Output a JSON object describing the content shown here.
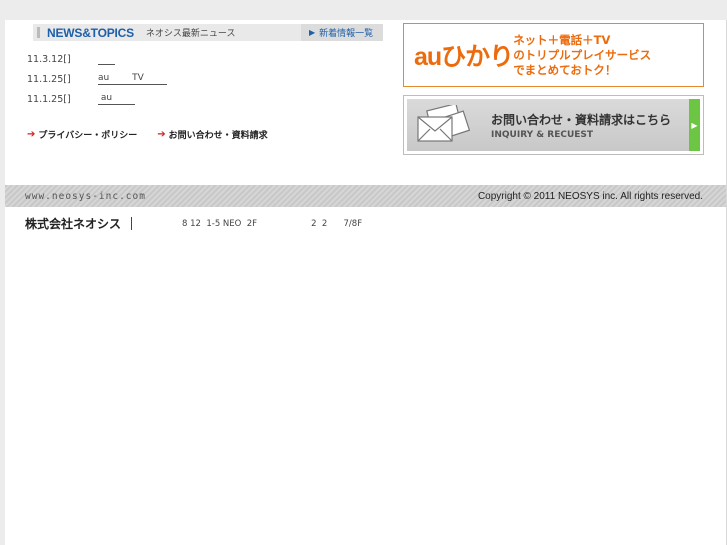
{
  "news": {
    "title": "NEWS&TOPICS",
    "subtitle": "ネオシス最新ニュース",
    "all_link": "新着情報一覧",
    "items": [
      {
        "date": "11.3.12[]",
        "text": "      "
      },
      {
        "date": "11.1.25[]",
        "text": "au        TV        "
      },
      {
        "date": "11.1.25[]",
        "text": " au        "
      }
    ]
  },
  "links": {
    "privacy": "プライバシー・ポリシー",
    "inquiry": "お問い合わせ・資料請求"
  },
  "au_banner": {
    "logo": "auひかり",
    "line1": "ネット＋電話＋TV",
    "line2": "のトリプルプレイサービス",
    "line3": "でまとめておトク！"
  },
  "inquiry_banner": {
    "jp": "お問い合わせ・資料請求はこちら",
    "en": "INQUIRY & RECUEST"
  },
  "footer": {
    "url": "www.neosys-inc.com",
    "copyright": "Copyright © 2011 NEOSYS inc. All rights reserved."
  },
  "company": {
    "name": "株式会社ネオシス",
    "address": "8 12  1-5 NEO  2F                    2  2      7/8F"
  },
  "colors": {
    "news_blue": "#1f5ea8",
    "au_orange": "#ec6b0c",
    "arrow_red": "#d42020",
    "inquiry_green": "#6cc644"
  }
}
